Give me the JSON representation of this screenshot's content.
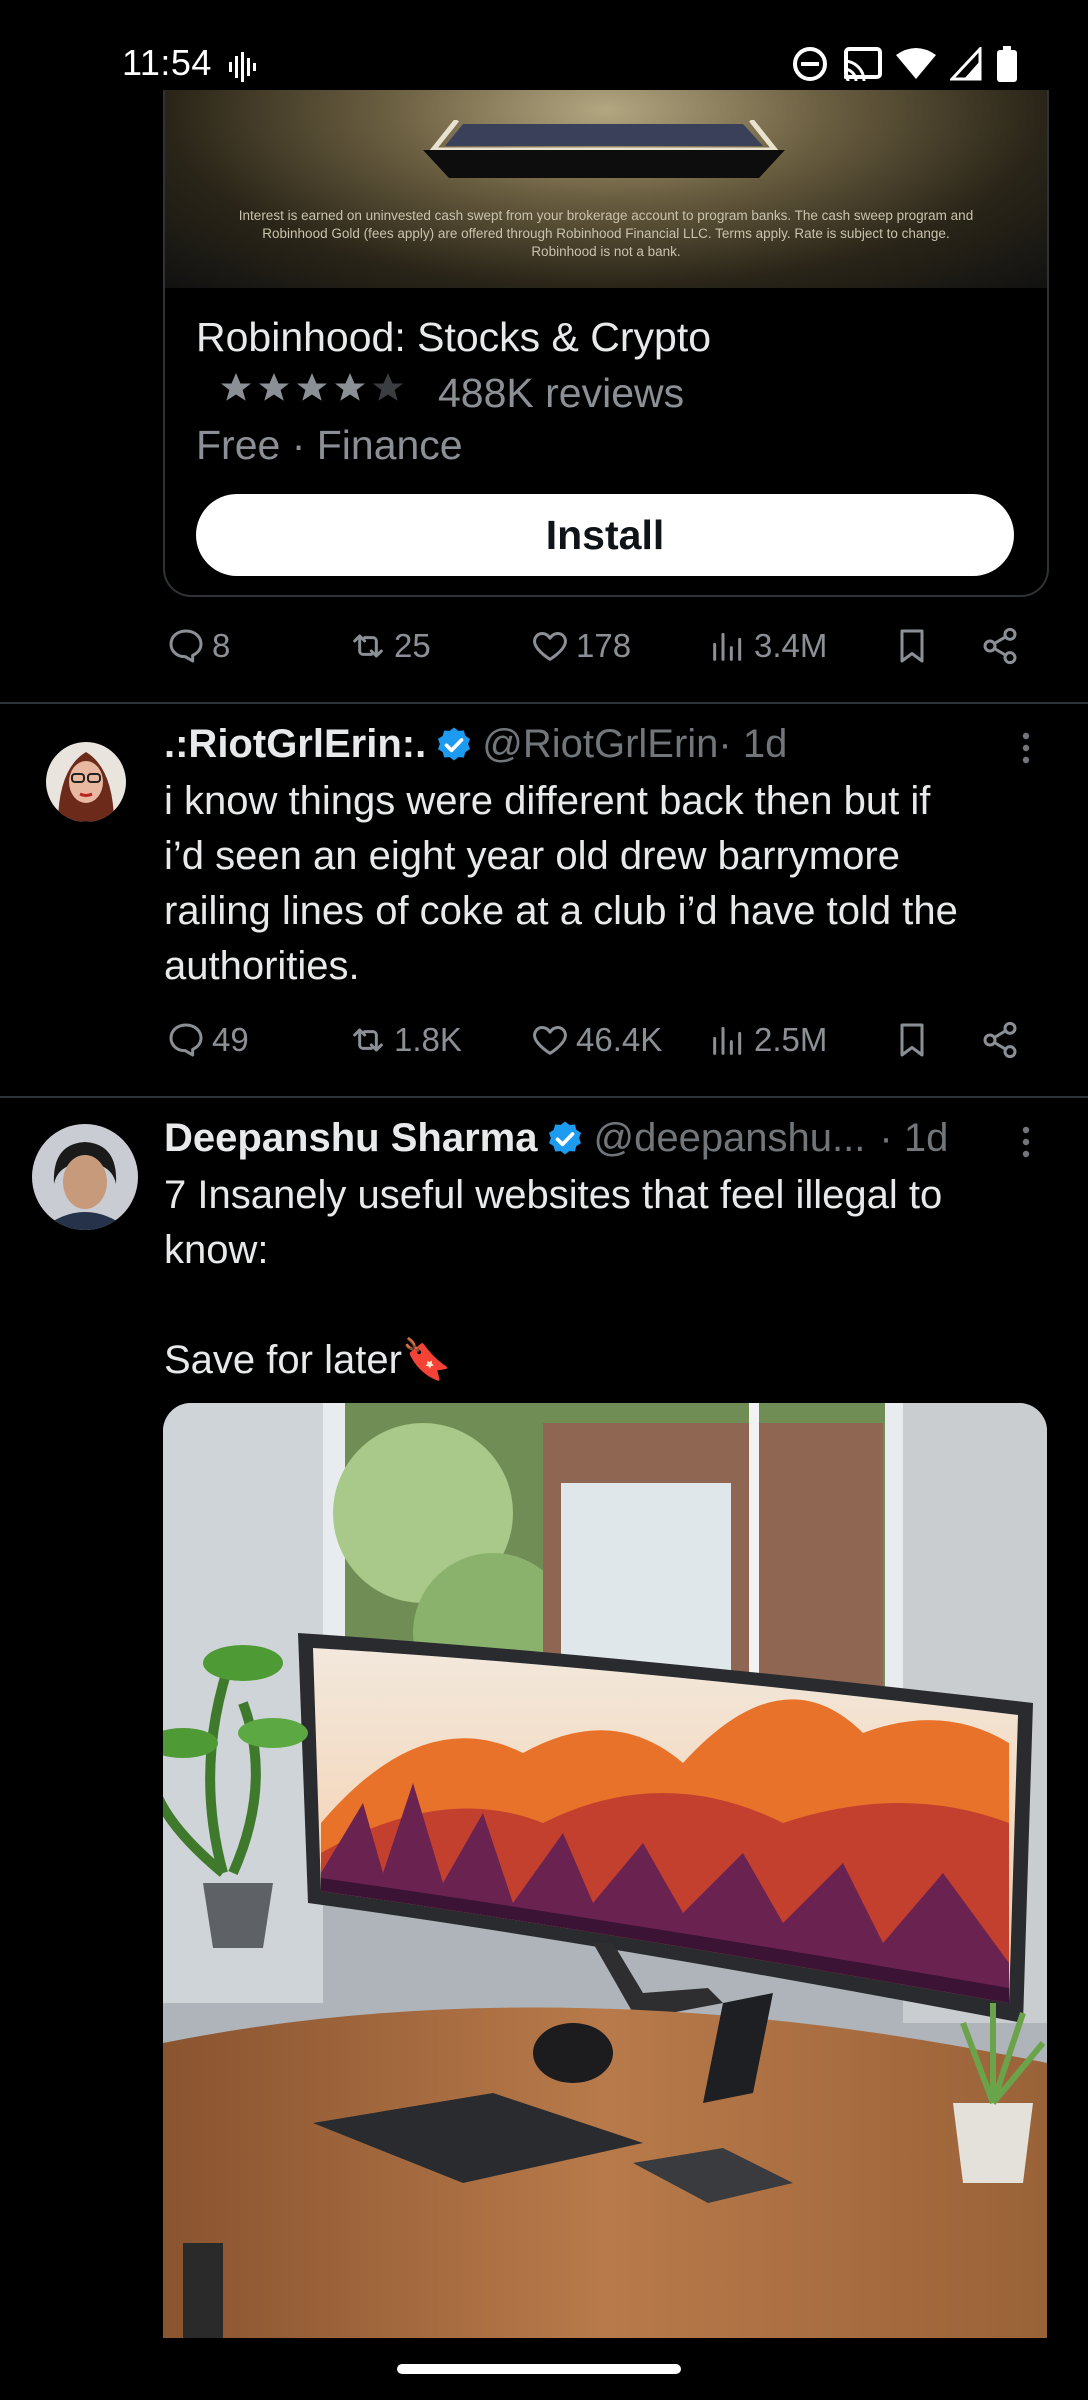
{
  "status_bar": {
    "time": "11:54"
  },
  "ad": {
    "disclaimer": "Interest is earned on uninvested cash swept from your brokerage account to program banks. The cash sweep program and Robinhood Gold (fees apply) are offered through Robinhood Financial LLC. Terms apply. Rate is subject to change. Robinhood is not a bank.",
    "app_name": "Robinhood: Stocks & Crypto",
    "rating": 4,
    "rating_max": 5,
    "reviews": "488K reviews",
    "meta": "Free · Finance",
    "install_label": "Install",
    "actions": {
      "replies": "8",
      "reposts": "25",
      "likes": "178",
      "views": "3.4M"
    }
  },
  "tweets": [
    {
      "name": ".:RiotGrlErin:.",
      "handle": "@RiotGrlErin",
      "time": " · 1d",
      "text": "i know things were different back then but if\ni’d seen an eight year old drew barrymore\nrailing lines of coke at a club i’d have told the\nauthorities.",
      "actions": {
        "replies": "49",
        "reposts": "1.8K",
        "likes": "46.4K",
        "views": "2.5M"
      }
    },
    {
      "name": "Deepanshu Sharma",
      "handle": "@deepanshu...",
      "time": " · 1d",
      "text": "7 Insanely useful websites that feel illegal to\nknow:\n\nSave for later🔖"
    }
  ],
  "colors": {
    "background": "#000000",
    "text": "#e7e9ea",
    "secondary": "#71767b",
    "verified": "#1d9bf0",
    "divider": "#2f3336"
  }
}
